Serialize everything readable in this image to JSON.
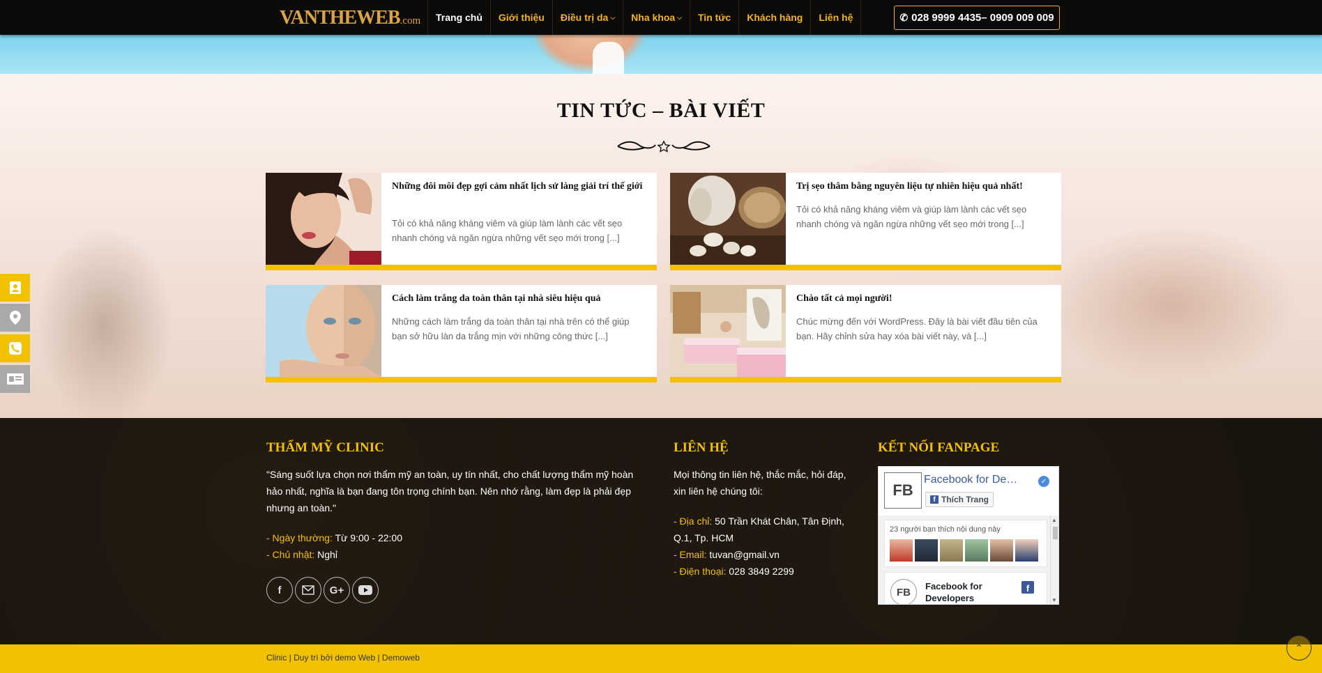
{
  "header": {
    "logo_main": "VANTHEWEB",
    "logo_suffix": ".com",
    "nav": [
      {
        "label": "Trang chủ",
        "active": true,
        "dropdown": false
      },
      {
        "label": "Giới thiệu",
        "active": false,
        "dropdown": false
      },
      {
        "label": "Điều trị da",
        "active": false,
        "dropdown": true
      },
      {
        "label": "Nha khoa",
        "active": false,
        "dropdown": true
      },
      {
        "label": "Tin tức",
        "active": false,
        "dropdown": false
      },
      {
        "label": "Khách hàng",
        "active": false,
        "dropdown": false
      },
      {
        "label": "Liên hệ",
        "active": false,
        "dropdown": false
      }
    ],
    "phone": "028 9999 4435– 0909 009 009"
  },
  "news": {
    "title": "TIN TỨC – BÀI VIẾT",
    "cards": [
      {
        "title": "Những đôi môi đẹp gợi cảm nhất lịch sử làng giải trí thế giới",
        "excerpt": "Tỏi có khả năng kháng viêm và giúp làm lành các vết sẹo nhanh chóng và ngăn ngừa những vết sẹo mới trong [...]"
      },
      {
        "title": "Trị sẹo thâm bằng nguyên liệu tự nhiên hiệu quả nhất!",
        "excerpt": "Tỏi có khả năng kháng viêm và giúp làm lành các vết sẹo nhanh chóng và ngăn ngừa những vết sẹo mới trong [...]"
      },
      {
        "title": "Cách làm trắng da toàn thân tại nhà siêu hiệu quả",
        "excerpt": "Những cách làm trắng da toàn thân tại nhà trên có thể giúp bạn sở hữu làn da trắng mịn với những công thức [...]"
      },
      {
        "title": "Chào tất cả mọi người!",
        "excerpt": "Chúc mừng đến với WordPress. Đây là bài viết đầu tiên của bạn. Hãy chỉnh sửa hay xóa bài viết này, và [...]"
      }
    ]
  },
  "footer": {
    "clinic": {
      "heading": "THẨM MỸ CLINIC",
      "quote": "\"Sáng suốt lựa chọn nơi thẩm mỹ an toàn, uy tín nhất, cho chất lượng thẩm mỹ hoàn hảo nhất, nghĩa là bạn đang tôn trọng chính bạn. Nên nhớ rằng, làm đẹp là phải đẹp nhưng an toàn.\"",
      "hours_label": "- Ngày thường:",
      "hours_value": "Từ 9:00 - 22:00",
      "sunday_label": "- Chủ nhật:",
      "sunday_value": "Nghỉ"
    },
    "contact": {
      "heading": "LIÊN HỆ",
      "intro": "Mọi thông tin liên hệ, thắc mắc, hỏi đáp, xin liên hệ chúng tôi:",
      "address_label": "- Địa chỉ:",
      "address_value": "50 Trần Khát Chân, Tân Định, Q.1, Tp. HCM",
      "email_label": "- Email:",
      "email_value": "tuvan@gmail.vn",
      "phone_label": "- Điện thoại:",
      "phone_value": "028 3849 2299"
    },
    "fanpage": {
      "heading": "KẾT NỐI FANPAGE",
      "logo_text": "FB",
      "page_name": "Facebook for De…",
      "like_label": "Thích Trang",
      "friends_text": "23 người bạn thích nội dung này",
      "post_name": "Facebook for Developers"
    },
    "copyright": "Clinic | Duy trì bởi demo Web | Demoweb"
  },
  "icons": {
    "phone": "phone-icon",
    "facebook": "facebook-icon",
    "email": "email-icon",
    "google_plus": "google-plus-icon",
    "youtube": "youtube-icon"
  },
  "colors": {
    "accent": "#f2c200",
    "nav_text": "#f2b31f",
    "footer_bg": "#17120d"
  }
}
